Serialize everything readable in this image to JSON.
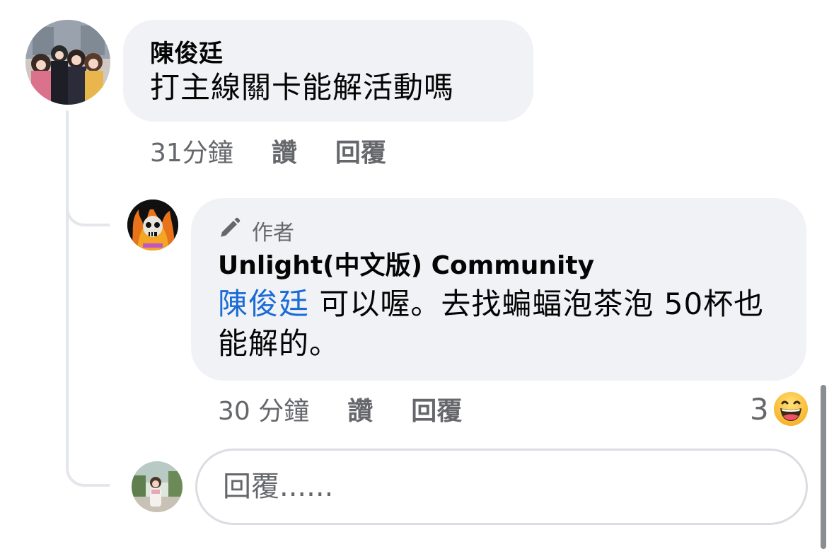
{
  "comment": {
    "author": "陳俊廷",
    "text": "打主線關卡能解活動嗎",
    "time": "31分鐘",
    "like_label": "讚",
    "reply_label": "回覆"
  },
  "reply": {
    "badge_label": "作者",
    "badge_icon": "pen-icon",
    "author": "Unlight(中文版) Community",
    "mention": "陳俊廷",
    "text": " 可以喔。去找蝙蝠泡茶泡 50杯也能解的。",
    "time": "30 分鐘",
    "like_label": "讚",
    "reply_label": "回覆",
    "reaction_count": "3",
    "reaction_icon": "haha-emoji-icon"
  },
  "composer": {
    "placeholder": "回覆......"
  },
  "colors": {
    "bubble_bg": "#f0f2f5",
    "meta_text": "#65676b",
    "mention": "#1b6bd6",
    "thread_line": "#e4e6eb"
  }
}
